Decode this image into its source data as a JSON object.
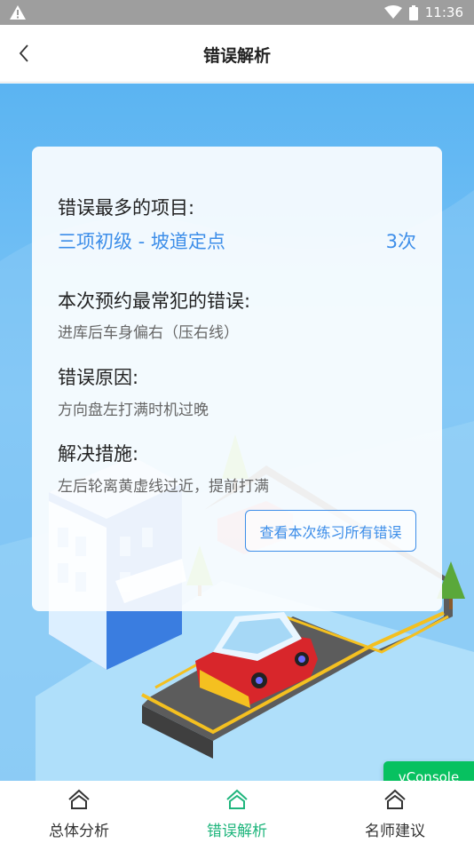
{
  "status_bar": {
    "time": "11:36"
  },
  "nav": {
    "title": "错误解析"
  },
  "card": {
    "most_errors_label": "错误最多的项目:",
    "project_name": "三项初级 - 坡道定点",
    "project_count": "3次",
    "common_error_label": "本次预约最常犯的错误:",
    "common_error_value": "进库后车身偏右（压右线）",
    "reason_label": "错误原因:",
    "reason_value": "方向盘左打满时机过晚",
    "solution_label": "解决措施:",
    "solution_value": "左后轮离黄虚线过近，提前打满",
    "view_all_button": "查看本次练习所有错误"
  },
  "vconsole": {
    "label": "vConsole"
  },
  "tabs": [
    {
      "label": "总体分析",
      "active": false
    },
    {
      "label": "错误解析",
      "active": true
    },
    {
      "label": "名师建议",
      "active": false
    }
  ],
  "colors": {
    "accent": "#3d8ee9",
    "tab_active": "#1eb57c",
    "vconsole": "#07c160"
  }
}
